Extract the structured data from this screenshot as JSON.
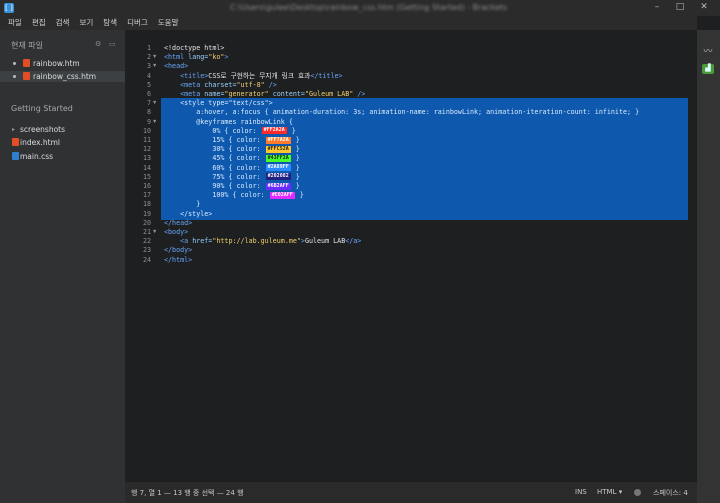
{
  "window": {
    "title": "C:\\Users\\gulee\\Desktop\\rainbow_css.htm (Getting Started) - Brackets"
  },
  "menu": [
    "파일",
    "편집",
    "검색",
    "보기",
    "탐색",
    "디버그",
    "도움말"
  ],
  "sidebar": {
    "working_files_title": "현재 파일",
    "working_files": [
      {
        "name": "rainbow.htm",
        "type": "html",
        "active": false
      },
      {
        "name": "rainbow_css.htm",
        "type": "html",
        "active": true
      }
    ],
    "project_title": "Getting Started",
    "project_files": [
      {
        "name": "screenshots",
        "type": "folder"
      },
      {
        "name": "index.html",
        "type": "html"
      },
      {
        "name": "main.css",
        "type": "css"
      }
    ]
  },
  "editor": {
    "lines": [
      {
        "n": "1",
        "fold": "",
        "sel": false,
        "segs": [
          {
            "c": "plain",
            "t": "<!doctype html>"
          }
        ]
      },
      {
        "n": "2",
        "fold": "▼",
        "sel": false,
        "segs": [
          {
            "c": "tag",
            "t": "<html"
          },
          {
            "c": "attr",
            "t": " lang="
          },
          {
            "c": "str",
            "t": "\"ko\""
          },
          {
            "c": "tag",
            "t": ">"
          }
        ]
      },
      {
        "n": "3",
        "fold": "▼",
        "sel": false,
        "segs": [
          {
            "c": "tag",
            "t": "<head>"
          }
        ]
      },
      {
        "n": "4",
        "fold": "",
        "sel": false,
        "segs": [
          {
            "c": "tag",
            "t": "    <title>"
          },
          {
            "c": "plain",
            "t": "CSS로 구현하는 무지개 링크 효과"
          },
          {
            "c": "tag",
            "t": "</title>"
          }
        ]
      },
      {
        "n": "5",
        "fold": "",
        "sel": false,
        "segs": [
          {
            "c": "tag",
            "t": "    <meta"
          },
          {
            "c": "attr",
            "t": " charset="
          },
          {
            "c": "str",
            "t": "\"utf-8\""
          },
          {
            "c": "tag",
            "t": " />"
          }
        ]
      },
      {
        "n": "6",
        "fold": "",
        "sel": false,
        "segs": [
          {
            "c": "tag",
            "t": "    <meta"
          },
          {
            "c": "attr",
            "t": " name="
          },
          {
            "c": "str",
            "t": "\"generator\""
          },
          {
            "c": "attr",
            "t": " content="
          },
          {
            "c": "str",
            "t": "\"Guleum LAB\""
          },
          {
            "c": "tag",
            "t": " />"
          }
        ]
      },
      {
        "n": "7",
        "fold": "▼",
        "sel": true,
        "segs": [
          {
            "c": "tag",
            "t": "    <style"
          },
          {
            "c": "attr",
            "t": " type="
          },
          {
            "c": "str",
            "t": "\"text/css\""
          },
          {
            "c": "tag",
            "t": ">"
          }
        ]
      },
      {
        "n": "8",
        "fold": "",
        "sel": true,
        "segs": [
          {
            "c": "plain",
            "t": "        a:hover, a:focus { animation-duration: 3s; animation-name: rainbowLink; animation-iteration-count: infinite; }"
          }
        ]
      },
      {
        "n": "9",
        "fold": "▼",
        "sel": true,
        "segs": [
          {
            "c": "plain",
            "t": "        @keyframes rainbowLink {"
          }
        ]
      },
      {
        "n": "10",
        "fold": "",
        "sel": true,
        "segs": [
          {
            "c": "plain",
            "t": "            0% { color: "
          },
          {
            "c": "swatch",
            "t": "#FF2A2A",
            "bg": "#FF2A2A",
            "fg": "#ffffff"
          },
          {
            "c": "plain",
            "t": " }"
          }
        ]
      },
      {
        "n": "11",
        "fold": "",
        "sel": true,
        "segs": [
          {
            "c": "plain",
            "t": "            15% { color: "
          },
          {
            "c": "swatch",
            "t": "#FF7A2A",
            "bg": "#FF7A2A",
            "fg": "#ffffff"
          },
          {
            "c": "plain",
            "t": " }"
          }
        ]
      },
      {
        "n": "12",
        "fold": "",
        "sel": true,
        "segs": [
          {
            "c": "plain",
            "t": "            30% { color: "
          },
          {
            "c": "swatch",
            "t": "#FFC52A",
            "bg": "#FFC52A",
            "fg": "#222222"
          },
          {
            "c": "plain",
            "t": " }"
          }
        ]
      },
      {
        "n": "13",
        "fold": "",
        "sel": true,
        "segs": [
          {
            "c": "plain",
            "t": "            45% { color: "
          },
          {
            "c": "swatch",
            "t": "#43FF2A",
            "bg": "#43FF2A",
            "fg": "#222222"
          },
          {
            "c": "plain",
            "t": " }"
          }
        ]
      },
      {
        "n": "14",
        "fold": "",
        "sel": true,
        "segs": [
          {
            "c": "plain",
            "t": "            60% { color: "
          },
          {
            "c": "swatch",
            "t": "#2A89FF",
            "bg": "#2A89FF",
            "fg": "#ffffff"
          },
          {
            "c": "plain",
            "t": " }"
          }
        ]
      },
      {
        "n": "15",
        "fold": "",
        "sel": true,
        "segs": [
          {
            "c": "plain",
            "t": "            75% { color: "
          },
          {
            "c": "swatch",
            "t": "#202082",
            "bg": "#202082",
            "fg": "#ffffff"
          },
          {
            "c": "plain",
            "t": " }"
          }
        ]
      },
      {
        "n": "16",
        "fold": "",
        "sel": true,
        "segs": [
          {
            "c": "plain",
            "t": "            90% { color: "
          },
          {
            "c": "swatch",
            "t": "#6B2AFF",
            "bg": "#6B2AFF",
            "fg": "#ffffff"
          },
          {
            "c": "plain",
            "t": " }"
          }
        ]
      },
      {
        "n": "17",
        "fold": "",
        "sel": true,
        "segs": [
          {
            "c": "plain",
            "t": "            100% { color: "
          },
          {
            "c": "swatch",
            "t": "#E02AFF",
            "bg": "#E02AFF",
            "fg": "#ffffff"
          },
          {
            "c": "plain",
            "t": " }"
          }
        ]
      },
      {
        "n": "18",
        "fold": "",
        "sel": true,
        "segs": [
          {
            "c": "plain",
            "t": "        }"
          }
        ]
      },
      {
        "n": "19",
        "fold": "",
        "sel": true,
        "segs": [
          {
            "c": "tag",
            "t": "    </style>"
          }
        ]
      },
      {
        "n": "20",
        "fold": "",
        "sel": false,
        "segs": [
          {
            "c": "tag",
            "t": "</head>"
          }
        ]
      },
      {
        "n": "21",
        "fold": "▼",
        "sel": false,
        "segs": [
          {
            "c": "tag",
            "t": "<body>"
          }
        ]
      },
      {
        "n": "22",
        "fold": "",
        "sel": false,
        "segs": [
          {
            "c": "tag",
            "t": "    <a"
          },
          {
            "c": "attr",
            "t": " href="
          },
          {
            "c": "str",
            "t": "\"http://lab.guleum.me\""
          },
          {
            "c": "tag",
            "t": ">"
          },
          {
            "c": "plain",
            "t": "Guleum LAB"
          },
          {
            "c": "tag",
            "t": "</a>"
          }
        ]
      },
      {
        "n": "23",
        "fold": "",
        "sel": false,
        "segs": [
          {
            "c": "tag",
            "t": "</body>"
          }
        ]
      },
      {
        "n": "24",
        "fold": "",
        "sel": false,
        "segs": [
          {
            "c": "tag",
            "t": "</html>"
          }
        ]
      }
    ]
  },
  "status": {
    "cursor": "행 7, 열 1 — 13 행 중 선택 — 24 행",
    "ins": "INS",
    "language": "HTML ▾",
    "spaces": "스페이스: 4"
  }
}
